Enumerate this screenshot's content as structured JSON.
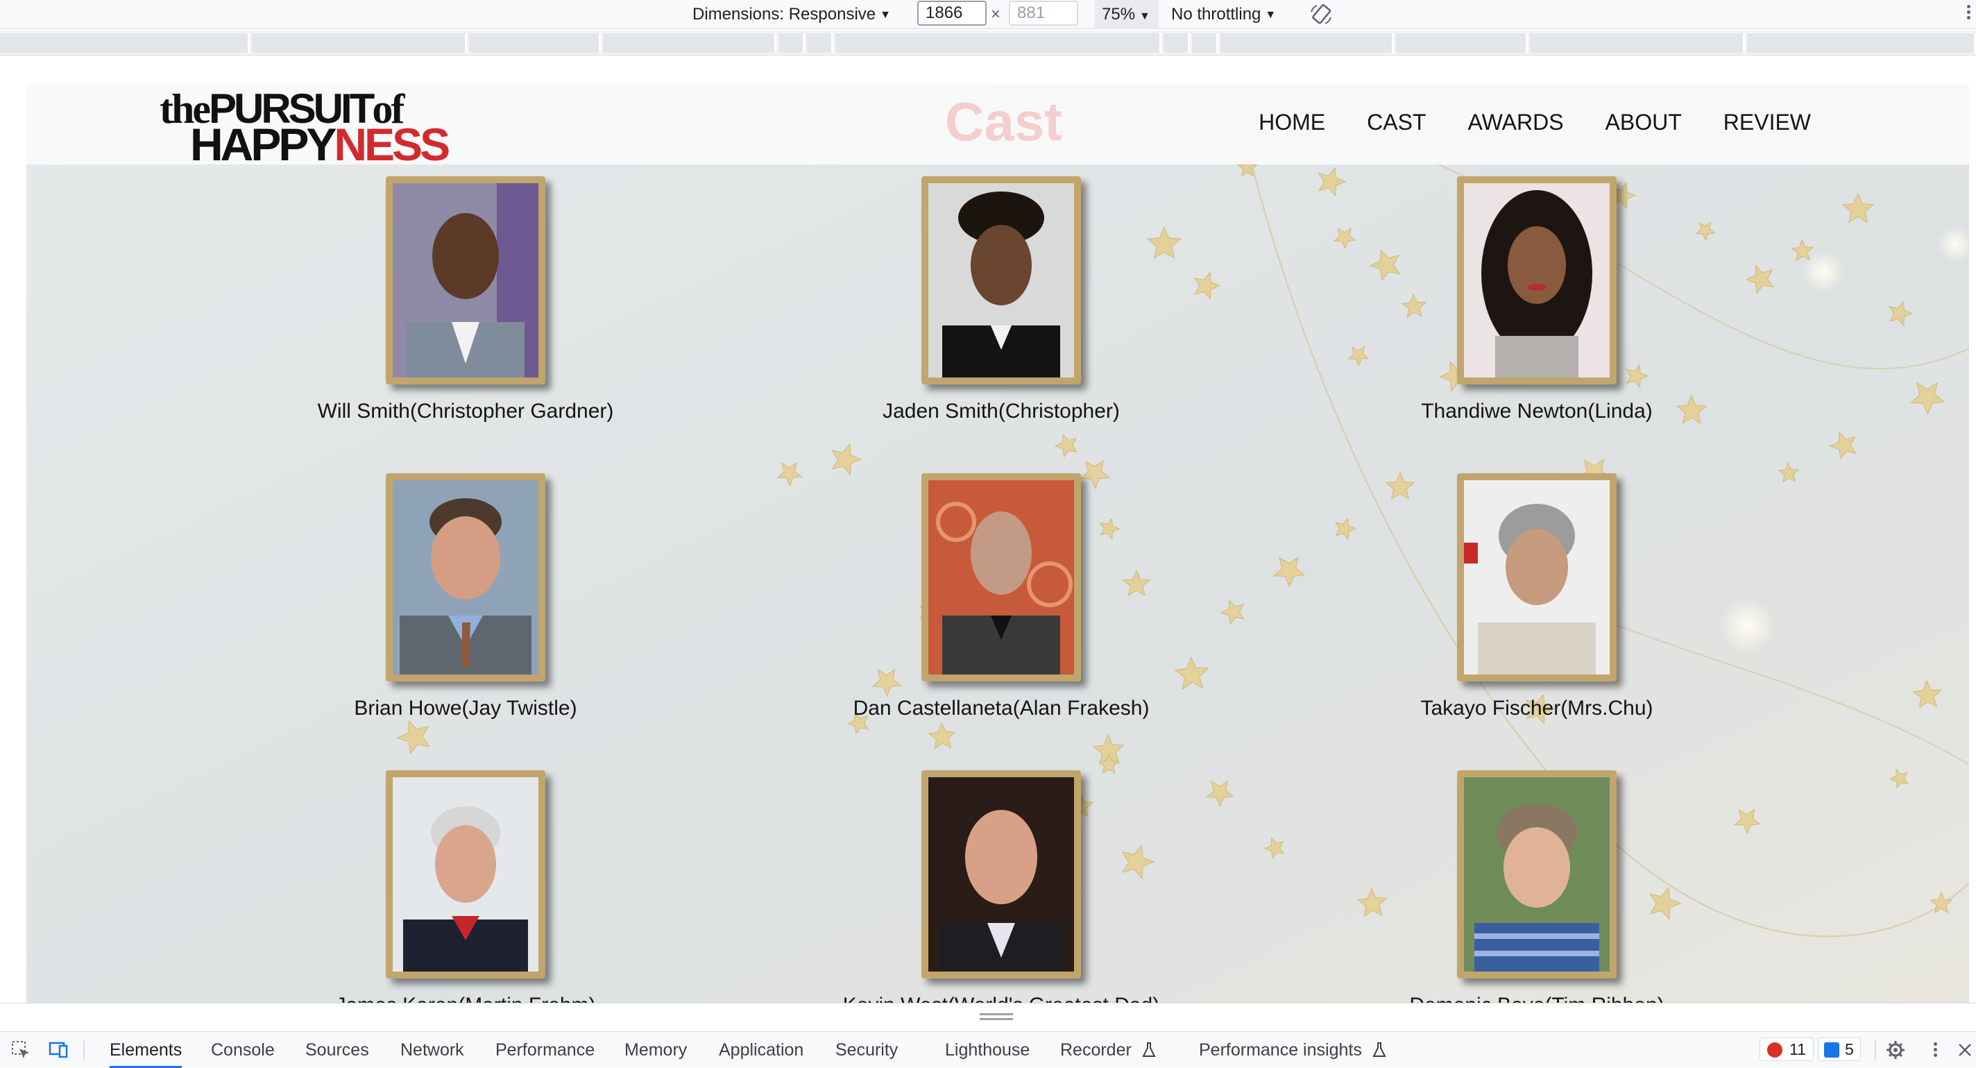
{
  "devtools_toolbar": {
    "dimensions_label": "Dimensions: Responsive",
    "width_value": "1866",
    "times_sign": "×",
    "height_placeholder": "881",
    "zoom": "75%",
    "throttling": "No throttling"
  },
  "site": {
    "logo": {
      "the": "the",
      "pursuit": "PURSUIT",
      "of": "of",
      "happy": "HAPPY",
      "ness": "NESS"
    },
    "page_title": "Cast",
    "nav": [
      "HOME",
      "CAST",
      "AWARDS",
      "ABOUT",
      "REVIEW"
    ],
    "cast": [
      {
        "name": "Will Smith(Christopher Gardner)"
      },
      {
        "name": "Jaden Smith(Christopher)"
      },
      {
        "name": "Thandiwe Newton(Linda)"
      },
      {
        "name": "Brian Howe(Jay Twistle)"
      },
      {
        "name": "Dan Castellaneta(Alan Frakesh)"
      },
      {
        "name": "Takayo Fischer(Mrs.Chu)"
      },
      {
        "name": "James Karen(Martin Frohm)"
      },
      {
        "name": "Kevin West(World's Greatest Dad)"
      },
      {
        "name": "Domenic Bove(Tim Ribbon)"
      }
    ]
  },
  "devtools_tabs": {
    "tabs": [
      "Elements",
      "Console",
      "Sources",
      "Network",
      "Performance",
      "Memory",
      "Application",
      "Security",
      "Lighthouse",
      "Recorder",
      "Performance insights"
    ],
    "active": "Elements",
    "errors_count": "11",
    "messages_count": "5"
  },
  "colors": {
    "logo_red": "#d22a2e",
    "frame_gold": "#c2a56c",
    "title_pink": "#f4cdcd",
    "tab_active": "#1a73e8"
  }
}
